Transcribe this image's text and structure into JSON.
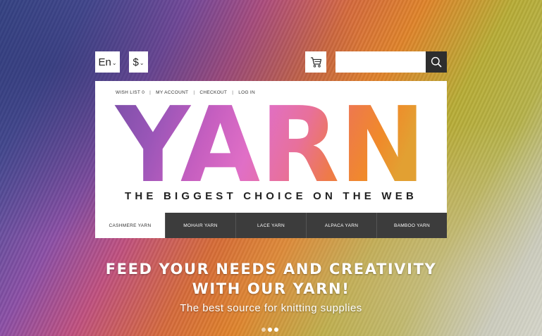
{
  "header": {
    "language": "En",
    "currency": "$",
    "search_placeholder": ""
  },
  "account_links": {
    "wishlist": "WISH LIST 0",
    "my_account": "MY ACCOUNT",
    "checkout": "CHECKOUT",
    "login": "LOG IN",
    "separator": "|"
  },
  "logo": {
    "text": "YARN",
    "tagline": "THE BIGGEST CHOICE ON THE WEB"
  },
  "nav": {
    "items": [
      {
        "label": "CASHMERE YARN"
      },
      {
        "label": "MOHAIR YARN"
      },
      {
        "label": "LACE YARN"
      },
      {
        "label": "ALPACA YARN"
      },
      {
        "label": "BAMBOO YARN"
      }
    ],
    "active_index": 0
  },
  "hero": {
    "title_line1": "FEED YOUR NEEDS AND CREATIVITY",
    "title_line2": "WITH OUR YARN!",
    "subtitle": "The best source for knitting supplies"
  },
  "slider": {
    "dot_count": 3,
    "active_dot": 2
  },
  "colors": {
    "dark": "#2e2e2e",
    "nav_bg": "#3c3c3c",
    "white": "#ffffff"
  }
}
